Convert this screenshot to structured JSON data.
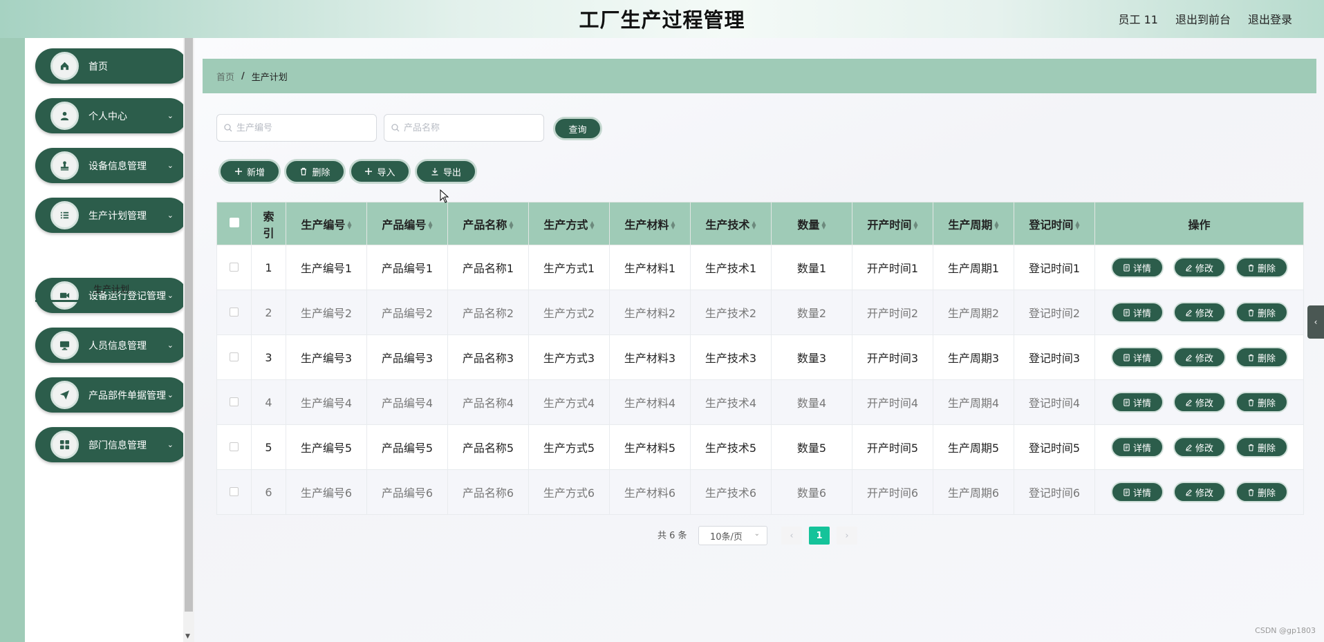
{
  "header": {
    "title": "工厂生产过程管理",
    "user": "员工 11",
    "front_link": "退出到前台",
    "logout_link": "退出登录"
  },
  "sidebar": {
    "items": [
      {
        "label": "首页",
        "icon": "home-icon",
        "expandable": false
      },
      {
        "label": "个人中心",
        "icon": "user-icon",
        "expandable": true
      },
      {
        "label": "设备信息管理",
        "icon": "stamp-icon",
        "expandable": true
      },
      {
        "label": "生产计划管理",
        "icon": "list-icon",
        "expandable": true
      },
      {
        "label": "设备运行登记管理",
        "icon": "video-icon",
        "expandable": true
      },
      {
        "label": "人员信息管理",
        "icon": "monitor-icon",
        "expandable": true
      },
      {
        "label": "产品部件单据管理",
        "icon": "send-icon",
        "expandable": true
      },
      {
        "label": "部门信息管理",
        "icon": "grid-icon",
        "expandable": true
      }
    ],
    "sub_item": "生产计划"
  },
  "breadcrumb": {
    "home": "首页",
    "separator": "/",
    "current": "生产计划"
  },
  "search": {
    "field1_placeholder": "生产编号",
    "field2_placeholder": "产品名称",
    "query_label": "查询"
  },
  "actions": {
    "add": "新增",
    "delete": "删除",
    "import": "导入",
    "export": "导出"
  },
  "table": {
    "columns": [
      "索引",
      "生产编号",
      "产品编号",
      "产品名称",
      "生产方式",
      "生产材料",
      "生产技术",
      "数量",
      "开产时间",
      "生产周期",
      "登记时间",
      "操作"
    ],
    "index_header_line1": "索",
    "index_header_line2": "引",
    "row_actions": {
      "detail": "详情",
      "edit": "修改",
      "delete": "删除"
    },
    "rows": [
      [
        "1",
        "生产编号1",
        "产品编号1",
        "产品名称1",
        "生产方式1",
        "生产材料1",
        "生产技术1",
        "数量1",
        "开产时间1",
        "生产周期1",
        "登记时间1"
      ],
      [
        "2",
        "生产编号2",
        "产品编号2",
        "产品名称2",
        "生产方式2",
        "生产材料2",
        "生产技术2",
        "数量2",
        "开产时间2",
        "生产周期2",
        "登记时间2"
      ],
      [
        "3",
        "生产编号3",
        "产品编号3",
        "产品名称3",
        "生产方式3",
        "生产材料3",
        "生产技术3",
        "数量3",
        "开产时间3",
        "生产周期3",
        "登记时间3"
      ],
      [
        "4",
        "生产编号4",
        "产品编号4",
        "产品名称4",
        "生产方式4",
        "生产材料4",
        "生产技术4",
        "数量4",
        "开产时间4",
        "生产周期4",
        "登记时间4"
      ],
      [
        "5",
        "生产编号5",
        "产品编号5",
        "产品名称5",
        "生产方式5",
        "生产材料5",
        "生产技术5",
        "数量5",
        "开产时间5",
        "生产周期5",
        "登记时间5"
      ],
      [
        "6",
        "生产编号6",
        "产品编号6",
        "产品名称6",
        "生产方式6",
        "生产材料6",
        "生产技术6",
        "数量6",
        "开产时间6",
        "生产周期6",
        "登记时间6"
      ]
    ]
  },
  "pagination": {
    "total": "共 6 条",
    "page_size": "10条/页",
    "current_page": "1",
    "prev": "‹",
    "next": "›"
  },
  "watermark": "CSDN @gp1803",
  "colors": {
    "primary": "#2c5d4b",
    "header_bg": "#9fcbb7",
    "pager_active": "#15c39a"
  }
}
